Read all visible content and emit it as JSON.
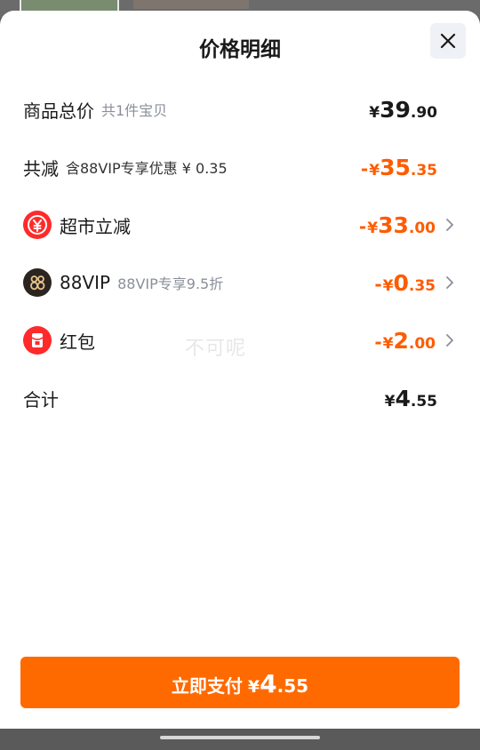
{
  "title": "价格明细",
  "summary": {
    "goods_label": "商品总价",
    "goods_sub": "共1件宝贝",
    "goods_cur": "¥",
    "goods_int": "39",
    "goods_dec": ".90",
    "reduce_label": "共减",
    "reduce_sub": "含88VIP专享优惠 ¥ 0.35",
    "reduce_neg": "-",
    "reduce_cur": "¥",
    "reduce_int": "35",
    "reduce_dec": ".35"
  },
  "items": [
    {
      "label": "超市立减",
      "sub": "",
      "neg": "-",
      "cur": "¥",
      "int": "33",
      "dec": ".00",
      "icon": "yuan-down-icon"
    },
    {
      "label": "88VIP",
      "sub": "88VIP专享9.5折",
      "neg": "-",
      "cur": "¥",
      "int": "0",
      "dec": ".35",
      "icon": "vip88-icon"
    },
    {
      "label": "红包",
      "sub": "",
      "neg": "-",
      "cur": "¥",
      "int": "2",
      "dec": ".00",
      "icon": "red-packet-icon"
    }
  ],
  "total": {
    "label": "合计",
    "cur": "¥",
    "int": "4",
    "dec": ".55"
  },
  "watermark": "不可呢",
  "pay_button": {
    "text": "立即支付",
    "cur": "¥",
    "int": "4",
    "dec": ".55"
  },
  "colors": {
    "accent": "#ff6a00",
    "discount": "#ff5b00",
    "icon_red": "#ff2a2a"
  }
}
